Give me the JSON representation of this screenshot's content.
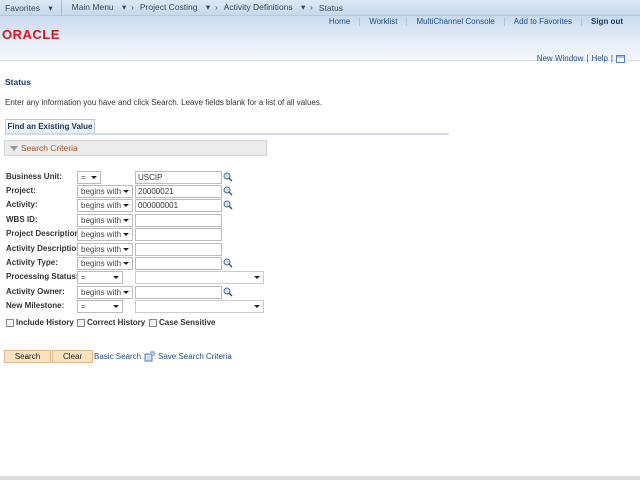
{
  "nav": {
    "favorites": "Favorites",
    "breadcrumbs": [
      "Main Menu",
      "Project Costing",
      "Activity Definitions"
    ],
    "current": "Status"
  },
  "header": {
    "logo": "ORACLE",
    "links": [
      "Home",
      "Worklist",
      "MultiChannel Console",
      "Add to Favorites"
    ],
    "signout": "Sign out"
  },
  "pagelinks": {
    "new_window": "New Window",
    "help": "Help"
  },
  "page": {
    "title": "Status",
    "instructions": "Enter any information you have and click Search. Leave fields blank for a list of all values.",
    "tab": "Find an Existing Value",
    "section": "Search Criteria"
  },
  "fields": [
    {
      "label": "Business Unit:",
      "op": "=",
      "value": "USCIP"
    },
    {
      "label": "Project:",
      "op": "begins with",
      "value": "20000021"
    },
    {
      "label": "Activity:",
      "op": "begins with",
      "value": "000000001"
    },
    {
      "label": "WBS ID:",
      "op": "begins with",
      "value": ""
    },
    {
      "label": "Project Description:",
      "op": "begins with",
      "value": ""
    },
    {
      "label": "Activity Description:",
      "op": "begins with",
      "value": ""
    },
    {
      "label": "Activity Type:",
      "op": "begins with",
      "value": ""
    },
    {
      "label": "Processing Status:",
      "op": "=",
      "value": ""
    },
    {
      "label": "Activity Owner:",
      "op": "begins with",
      "value": ""
    },
    {
      "label": "New Milestone:",
      "op": "=",
      "value": ""
    }
  ],
  "checkboxes": [
    {
      "label": "Include History",
      "checked": false
    },
    {
      "label": "Correct History",
      "checked": false
    },
    {
      "label": "Case Sensitive",
      "checked": false
    }
  ],
  "buttons": {
    "search": "Search",
    "clear": "Clear",
    "basic": "Basic Search",
    "save": "Save Search Criteria"
  }
}
